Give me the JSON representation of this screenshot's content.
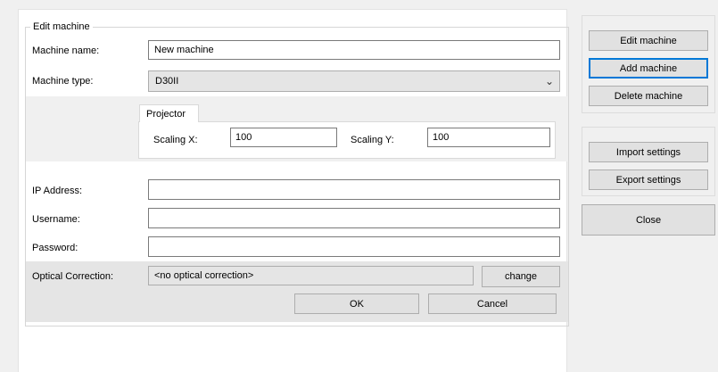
{
  "group": {
    "title": "Edit machine"
  },
  "fields": {
    "machine_name": {
      "label": "Machine name:",
      "value": "New machine"
    },
    "machine_type": {
      "label": "Machine type:",
      "value": "D30II"
    },
    "projector": {
      "tab_label": "Projector",
      "scaling_x": {
        "label": "Scaling X:",
        "value": "100"
      },
      "scaling_y": {
        "label": "Scaling Y:",
        "value": "100"
      }
    },
    "ip_address": {
      "label": "IP Address:",
      "value": ""
    },
    "username": {
      "label": "Username:",
      "value": ""
    },
    "password": {
      "label": "Password:",
      "value": ""
    },
    "optical_correction": {
      "label": "Optical Correction:",
      "value": "<no optical correction>",
      "change_label": "change"
    }
  },
  "dialog": {
    "ok_label": "OK",
    "cancel_label": "Cancel"
  },
  "sidebar": {
    "edit_machine": "Edit machine",
    "add_machine": "Add machine",
    "delete_machine": "Delete machine",
    "import_settings": "Import settings",
    "export_settings": "Export settings",
    "close": "Close"
  },
  "colors": {
    "focus_border": "#0078d7",
    "button_bg": "#e1e1e1",
    "panel_bg": "#f0f0f0"
  },
  "icons": {
    "dropdown": "chevron-down-icon"
  }
}
